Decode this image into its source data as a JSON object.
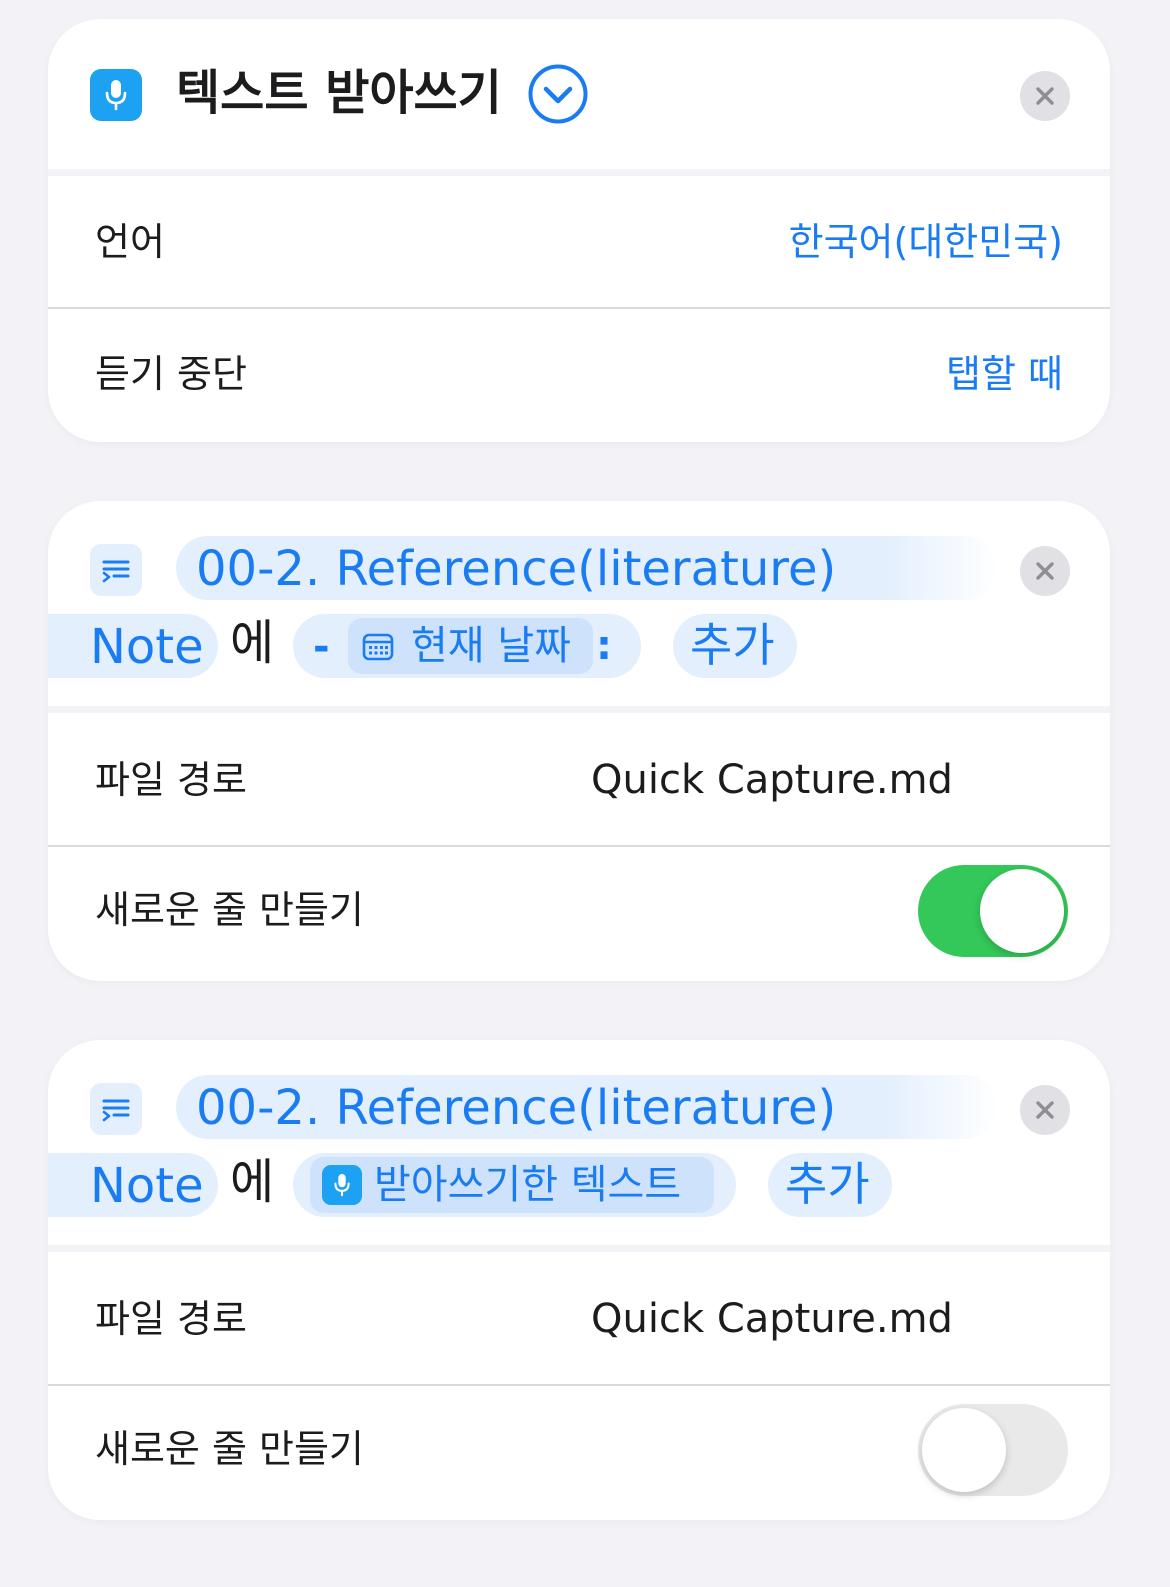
{
  "dictation_card": {
    "title": "텍스트 받아쓰기",
    "icon": "microphone-icon",
    "rows": [
      {
        "label": "언어",
        "value": "한국어(대한민국)"
      },
      {
        "label": "듣기 중단",
        "value": "탭할 때"
      }
    ]
  },
  "append_card_1": {
    "icon": "append-text-icon",
    "target_folder": "00-2. Reference(literature)",
    "target_note": "Note",
    "connector": "에",
    "dash": "-",
    "variable_icon": "calendar-icon",
    "variable": "현재 날짜",
    "colon": ":",
    "action": "추가",
    "file_path_label": "파일 경로",
    "file_path_value": "Quick Capture.md",
    "new_line_label": "새로운 줄 만들기",
    "new_line_enabled": true
  },
  "append_card_2": {
    "icon": "append-text-icon",
    "target_folder": "00-2. Reference(literature)",
    "target_note": "Note",
    "connector": "에",
    "variable_icon": "microphone-icon",
    "variable": "받아쓰기한 텍스트",
    "action": "추가",
    "file_path_label": "파일 경로",
    "file_path_value": "Quick Capture.md",
    "new_line_label": "새로운 줄 만들기",
    "new_line_enabled": false
  },
  "colors": {
    "accent": "#1a7cf2",
    "toggle_on": "#34c759",
    "background": "#f2f2f7"
  }
}
